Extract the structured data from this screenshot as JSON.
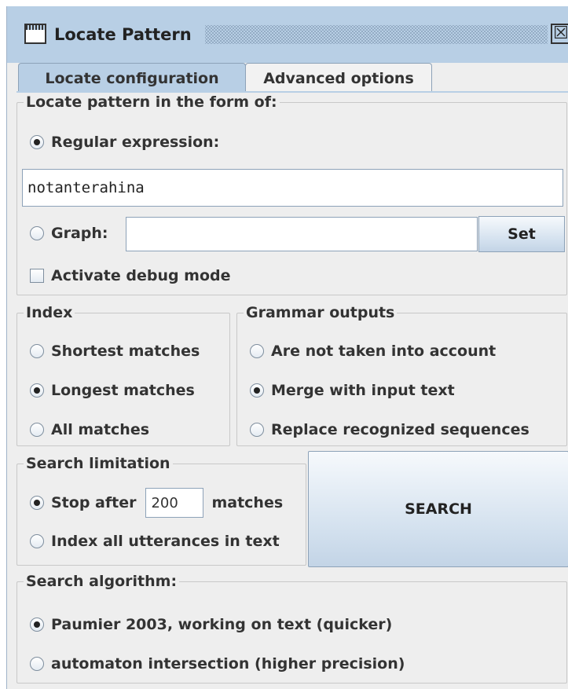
{
  "window": {
    "title": "Locate Pattern",
    "close_symbol": "☒"
  },
  "tabs": [
    {
      "label": "Locate configuration",
      "active": true
    },
    {
      "label": "Advanced options",
      "active": false
    }
  ],
  "pattern": {
    "legend": "Locate pattern in the form of:",
    "regex_label": "Regular expression:",
    "regex_selected": true,
    "regex_value": "notanterahina",
    "graph_label": "Graph:",
    "graph_selected": false,
    "graph_value": "",
    "set_button": "Set",
    "debug_label": "Activate debug mode",
    "debug_checked": false
  },
  "index": {
    "legend": "Index",
    "options": [
      {
        "label": "Shortest matches",
        "selected": false
      },
      {
        "label": "Longest matches",
        "selected": true
      },
      {
        "label": "All matches",
        "selected": false
      }
    ]
  },
  "grammar_outputs": {
    "legend": "Grammar outputs",
    "options": [
      {
        "label": "Are not taken into account",
        "selected": false
      },
      {
        "label": "Merge with input text",
        "selected": true
      },
      {
        "label": "Replace recognized sequences",
        "selected": false
      }
    ]
  },
  "search_limitation": {
    "legend": "Search limitation",
    "stop_after_label": "Stop after",
    "stop_after_value": "200",
    "matches_label": "matches",
    "stop_after_selected": true,
    "index_all_label": "Index all utterances in text",
    "index_all_selected": false
  },
  "search_button": "SEARCH",
  "search_algorithm": {
    "legend": "Search algorithm:",
    "options": [
      {
        "label": "Paumier 2003, working on text (quicker)",
        "selected": true
      },
      {
        "label": "automaton intersection (higher precision)",
        "selected": false
      }
    ]
  },
  "colors": {
    "titlebar": "#b8cfe5",
    "panel": "#eeeeee",
    "border": "#8da2b8"
  }
}
